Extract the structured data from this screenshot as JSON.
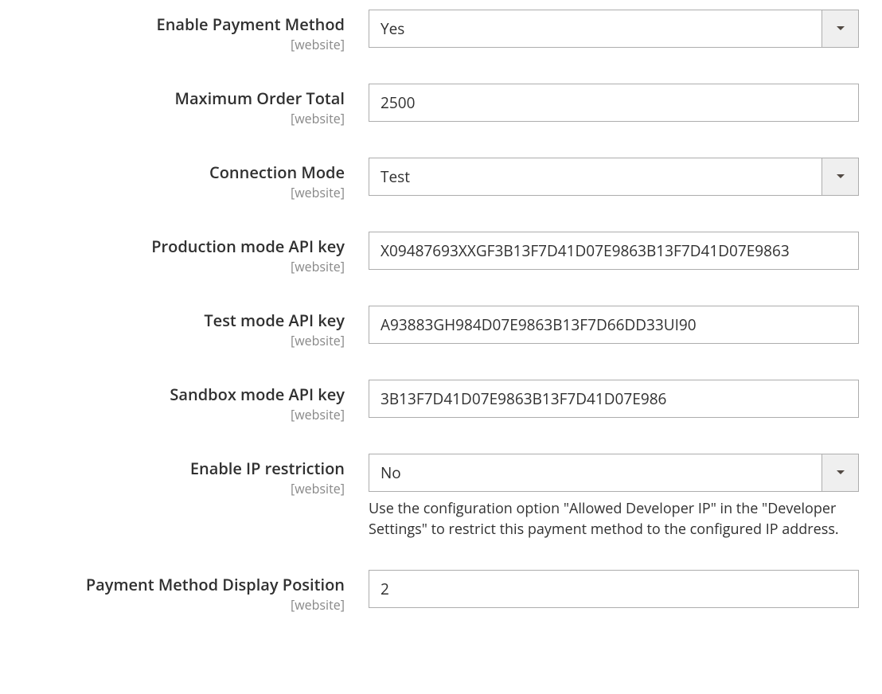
{
  "scope_label": "[website]",
  "fields": {
    "enable_payment": {
      "label": "Enable Payment Method",
      "value": "Yes"
    },
    "max_order_total": {
      "label": "Maximum Order Total",
      "value": "2500"
    },
    "connection_mode": {
      "label": "Connection Mode",
      "value": "Test"
    },
    "prod_api_key": {
      "label": "Production mode API key",
      "value": "X09487693XXGF3B13F7D41D07E9863B13F7D41D07E9863"
    },
    "test_api_key": {
      "label": "Test mode API key",
      "value": "A93883GH984D07E9863B13F7D66DD33UI90"
    },
    "sandbox_api_key": {
      "label": "Sandbox mode API key",
      "value": "3B13F7D41D07E9863B13F7D41D07E986"
    },
    "enable_ip_restriction": {
      "label": "Enable IP restriction",
      "value": "No",
      "helper": "Use the configuration option \"Allowed Developer IP\" in the \"Developer Settings\" to restrict this payment method to the configured IP address."
    },
    "display_position": {
      "label": "Payment Method Display Position",
      "value": "2"
    }
  }
}
